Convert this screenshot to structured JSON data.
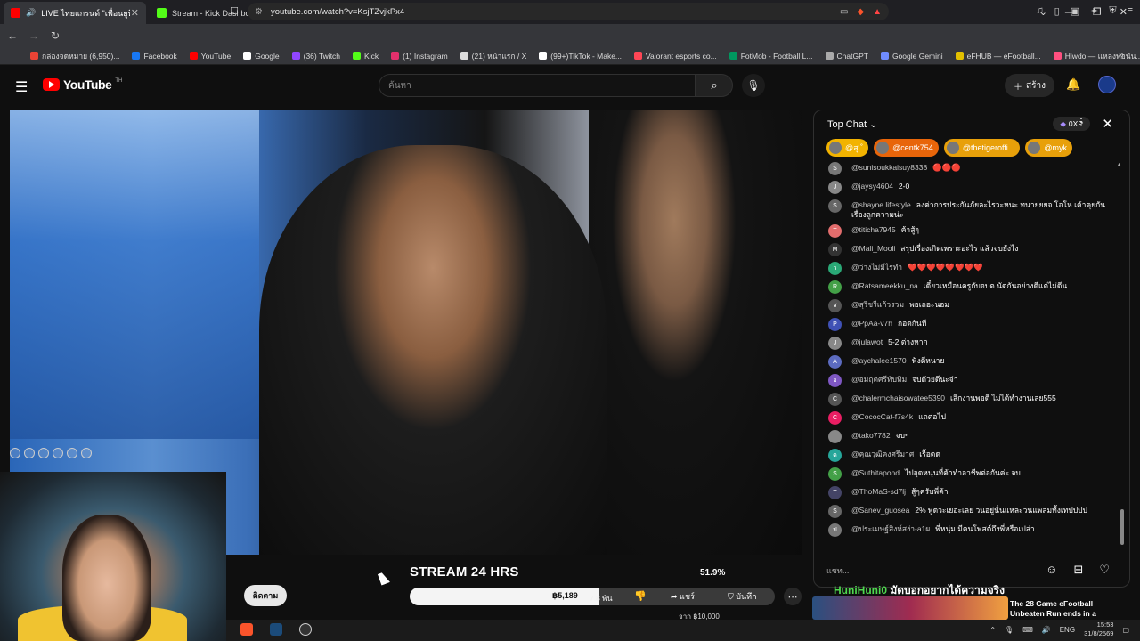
{
  "browser": {
    "tabs": [
      {
        "title": "LIVE ไทยแกรนด์ \"เพื่อนยูทิวบ์ร...",
        "active": true,
        "color": "#ff0000"
      },
      {
        "title": "Stream - Kick Dashboard",
        "active": false,
        "color": "#53fc18"
      }
    ],
    "new_tab": "+",
    "window_controls": [
      "⌄",
      "—",
      "❐",
      "✕"
    ],
    "url": "youtube.com/watch?v=KsjTZvjkPx4",
    "bookmarks": [
      {
        "label": "กล่องจดหมาย (6,950)...",
        "color": "#ea4335"
      },
      {
        "label": "Facebook",
        "color": "#1877f2"
      },
      {
        "label": "YouTube",
        "color": "#ff0000"
      },
      {
        "label": "Google",
        "color": "#ffffff"
      },
      {
        "label": "(36) Twitch",
        "color": "#9146ff"
      },
      {
        "label": "Kick",
        "color": "#53fc18"
      },
      {
        "label": "(1) Instagram",
        "color": "#e1306c"
      },
      {
        "label": "(21) หน้าแรก / X",
        "color": "#dddddd"
      },
      {
        "label": "(99+)TikTok - Make...",
        "color": "#ffffff"
      },
      {
        "label": "Valorant esports co...",
        "color": "#ff4655"
      },
      {
        "label": "FotMob - Football L...",
        "color": "#00985f"
      },
      {
        "label": "ChatGPT",
        "color": "#aaaaaa"
      },
      {
        "label": "Google Gemini",
        "color": "#6f8cff"
      },
      {
        "label": "eFHUB — eFootball...",
        "color": "#e3c000"
      },
      {
        "label": "Hiwdo — แหลงพ่อนัน...",
        "color": "#ff5080"
      }
    ]
  },
  "youtube": {
    "logo_text": "YouTube",
    "logo_region": "TH",
    "search_placeholder": "ค้นหา",
    "create_label": "สร้าง"
  },
  "stream_overlay": {
    "goal_title": "STREAM 24 HRS",
    "goal_percent": "51.9%",
    "goal_progress": 0.519,
    "goal_amount": "฿5,189",
    "goal_target": "จาก ฿10,000",
    "likes": "7.8 พัน",
    "share": "แชร์",
    "save": "บันทึก",
    "follow": "ติดตาม"
  },
  "chat": {
    "title": "Top Chat",
    "xp": "0XP",
    "tickers": [
      {
        "name": "@สุ ˚",
        "color": "#f2b300"
      },
      {
        "name": "@centk754",
        "color": "#e8650a"
      },
      {
        "name": "@thetigeroffi...",
        "color": "#e8a00a"
      },
      {
        "name": "@myk",
        "color": "#e8a00a"
      }
    ],
    "messages": [
      {
        "author": "@sunisoukkaisuy8338",
        "text": "🔴🔴🔴",
        "color": "#777777"
      },
      {
        "author": "@jaysy4604",
        "text": "2-0",
        "color": "#888888"
      },
      {
        "author": "@shayne.lifestyle",
        "text": "ลงค่าการประกันภัยละไรวะหนะ ทนายยยจ โอโห เค้าคุยกันเรื่องลูกความน่ะ",
        "color": "#666666"
      },
      {
        "author": "@titicha7945",
        "text": "ค้าสู้ๆ",
        "color": "#e26d6d"
      },
      {
        "author": "@Mali_Mooli",
        "text": "สรุปเรื่องเกิดเพราะอะไร แล้วจบยังไง",
        "color": "#333333"
      },
      {
        "author": "@ว่างไม่มีไรทำ",
        "text": "❤️❤️❤️❤️❤️❤️❤️❤️",
        "color": "#2aa876"
      },
      {
        "author": "@Ratsameekku_na",
        "text": "เดี๋ยวเหมือนครูกับอบต.นัดกันอย่างดีแต่ไม่ดีน",
        "color": "#43a047"
      },
      {
        "author": "@สุริชรีแก้วรวม",
        "text": "พอเถอะนอม",
        "color": "#555555"
      },
      {
        "author": "@PpAa-v7h",
        "text": "กอดกันที",
        "color": "#3f51b5"
      },
      {
        "author": "@julawot",
        "text": "5-2 ต่างหาก",
        "color": "#888888"
      },
      {
        "author": "@aychalee1570",
        "text": "ฟังดีหนาย",
        "color": "#5c6bc0"
      },
      {
        "author": "@อมฤตศรีทับทิม",
        "text": "จบด้วยดีนะจ๋า",
        "color": "#7e57c2"
      },
      {
        "author": "@chalermchaisowatee5390",
        "text": "เลิกงานพอดี ไม่ได้ทำงานเลย555",
        "color": "#555555"
      },
      {
        "author": "@CococCat-f7s4k",
        "text": "แถต่อไป",
        "color": "#e91e63"
      },
      {
        "author": "@tako7782",
        "text": "จบๆ",
        "color": "#888888"
      },
      {
        "author": "@คุณวุฒิคงศรีมาศ",
        "text": "เรื้อดด",
        "color": "#26a69a"
      },
      {
        "author": "@Suthitapond",
        "text": "ไปอุดหนุนที่ค้าทำอาชีพต่อกันค่ะ จบ",
        "color": "#43a047"
      },
      {
        "author": "@ThoMaS-sd7lj",
        "text": "สู้ๆครับพี่ค้า",
        "color": "#444466"
      },
      {
        "author": "@Sanev_guosea",
        "text": "2% พูดวะเยอะเลย วนอยู่นั่นแหละวนแพล่มทั้งเทปปปป",
        "color": "#666666"
      },
      {
        "author": "@ประเมษฐ์สิงห์สง่า-a1ผ",
        "text": "พี่หนุ่ม มีคนโพสต์ถึงพี่หรือเปล่า........",
        "color": "#777777"
      }
    ],
    "input_placeholder": "แชท...",
    "pinned_user": "HuniHuni0",
    "pinned_text": "มัดบอกอยากได้ความจริง",
    "promo_text": "The 28 Game eFootball Unbeaten Run ends in a"
  },
  "taskbar": {
    "lang": "ENG",
    "time": "15:53",
    "date": "31/8/2569"
  }
}
